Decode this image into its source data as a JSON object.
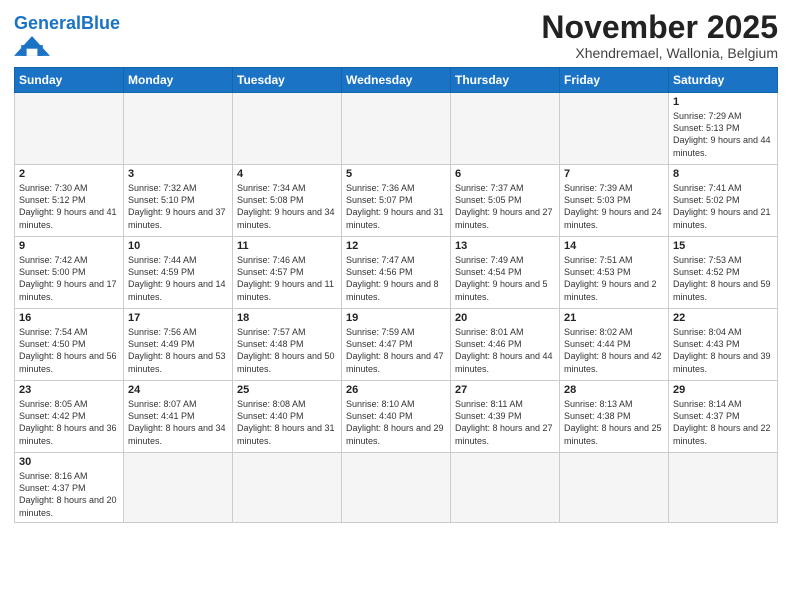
{
  "logo": {
    "general": "General",
    "blue": "Blue"
  },
  "title": {
    "month_year": "November 2025",
    "location": "Xhendremael, Wallonia, Belgium"
  },
  "weekdays": [
    "Sunday",
    "Monday",
    "Tuesday",
    "Wednesday",
    "Thursday",
    "Friday",
    "Saturday"
  ],
  "weeks": [
    [
      {
        "day": "",
        "info": ""
      },
      {
        "day": "",
        "info": ""
      },
      {
        "day": "",
        "info": ""
      },
      {
        "day": "",
        "info": ""
      },
      {
        "day": "",
        "info": ""
      },
      {
        "day": "",
        "info": ""
      },
      {
        "day": "1",
        "info": "Sunrise: 7:29 AM\nSunset: 5:13 PM\nDaylight: 9 hours and 44 minutes."
      }
    ],
    [
      {
        "day": "2",
        "info": "Sunrise: 7:30 AM\nSunset: 5:12 PM\nDaylight: 9 hours and 41 minutes."
      },
      {
        "day": "3",
        "info": "Sunrise: 7:32 AM\nSunset: 5:10 PM\nDaylight: 9 hours and 37 minutes."
      },
      {
        "day": "4",
        "info": "Sunrise: 7:34 AM\nSunset: 5:08 PM\nDaylight: 9 hours and 34 minutes."
      },
      {
        "day": "5",
        "info": "Sunrise: 7:36 AM\nSunset: 5:07 PM\nDaylight: 9 hours and 31 minutes."
      },
      {
        "day": "6",
        "info": "Sunrise: 7:37 AM\nSunset: 5:05 PM\nDaylight: 9 hours and 27 minutes."
      },
      {
        "day": "7",
        "info": "Sunrise: 7:39 AM\nSunset: 5:03 PM\nDaylight: 9 hours and 24 minutes."
      },
      {
        "day": "8",
        "info": "Sunrise: 7:41 AM\nSunset: 5:02 PM\nDaylight: 9 hours and 21 minutes."
      }
    ],
    [
      {
        "day": "9",
        "info": "Sunrise: 7:42 AM\nSunset: 5:00 PM\nDaylight: 9 hours and 17 minutes."
      },
      {
        "day": "10",
        "info": "Sunrise: 7:44 AM\nSunset: 4:59 PM\nDaylight: 9 hours and 14 minutes."
      },
      {
        "day": "11",
        "info": "Sunrise: 7:46 AM\nSunset: 4:57 PM\nDaylight: 9 hours and 11 minutes."
      },
      {
        "day": "12",
        "info": "Sunrise: 7:47 AM\nSunset: 4:56 PM\nDaylight: 9 hours and 8 minutes."
      },
      {
        "day": "13",
        "info": "Sunrise: 7:49 AM\nSunset: 4:54 PM\nDaylight: 9 hours and 5 minutes."
      },
      {
        "day": "14",
        "info": "Sunrise: 7:51 AM\nSunset: 4:53 PM\nDaylight: 9 hours and 2 minutes."
      },
      {
        "day": "15",
        "info": "Sunrise: 7:53 AM\nSunset: 4:52 PM\nDaylight: 8 hours and 59 minutes."
      }
    ],
    [
      {
        "day": "16",
        "info": "Sunrise: 7:54 AM\nSunset: 4:50 PM\nDaylight: 8 hours and 56 minutes."
      },
      {
        "day": "17",
        "info": "Sunrise: 7:56 AM\nSunset: 4:49 PM\nDaylight: 8 hours and 53 minutes."
      },
      {
        "day": "18",
        "info": "Sunrise: 7:57 AM\nSunset: 4:48 PM\nDaylight: 8 hours and 50 minutes."
      },
      {
        "day": "19",
        "info": "Sunrise: 7:59 AM\nSunset: 4:47 PM\nDaylight: 8 hours and 47 minutes."
      },
      {
        "day": "20",
        "info": "Sunrise: 8:01 AM\nSunset: 4:46 PM\nDaylight: 8 hours and 44 minutes."
      },
      {
        "day": "21",
        "info": "Sunrise: 8:02 AM\nSunset: 4:44 PM\nDaylight: 8 hours and 42 minutes."
      },
      {
        "day": "22",
        "info": "Sunrise: 8:04 AM\nSunset: 4:43 PM\nDaylight: 8 hours and 39 minutes."
      }
    ],
    [
      {
        "day": "23",
        "info": "Sunrise: 8:05 AM\nSunset: 4:42 PM\nDaylight: 8 hours and 36 minutes."
      },
      {
        "day": "24",
        "info": "Sunrise: 8:07 AM\nSunset: 4:41 PM\nDaylight: 8 hours and 34 minutes."
      },
      {
        "day": "25",
        "info": "Sunrise: 8:08 AM\nSunset: 4:40 PM\nDaylight: 8 hours and 31 minutes."
      },
      {
        "day": "26",
        "info": "Sunrise: 8:10 AM\nSunset: 4:40 PM\nDaylight: 8 hours and 29 minutes."
      },
      {
        "day": "27",
        "info": "Sunrise: 8:11 AM\nSunset: 4:39 PM\nDaylight: 8 hours and 27 minutes."
      },
      {
        "day": "28",
        "info": "Sunrise: 8:13 AM\nSunset: 4:38 PM\nDaylight: 8 hours and 25 minutes."
      },
      {
        "day": "29",
        "info": "Sunrise: 8:14 AM\nSunset: 4:37 PM\nDaylight: 8 hours and 22 minutes."
      }
    ],
    [
      {
        "day": "30",
        "info": "Sunrise: 8:16 AM\nSunset: 4:37 PM\nDaylight: 8 hours and 20 minutes."
      },
      {
        "day": "",
        "info": ""
      },
      {
        "day": "",
        "info": ""
      },
      {
        "day": "",
        "info": ""
      },
      {
        "day": "",
        "info": ""
      },
      {
        "day": "",
        "info": ""
      },
      {
        "day": "",
        "info": ""
      }
    ]
  ]
}
